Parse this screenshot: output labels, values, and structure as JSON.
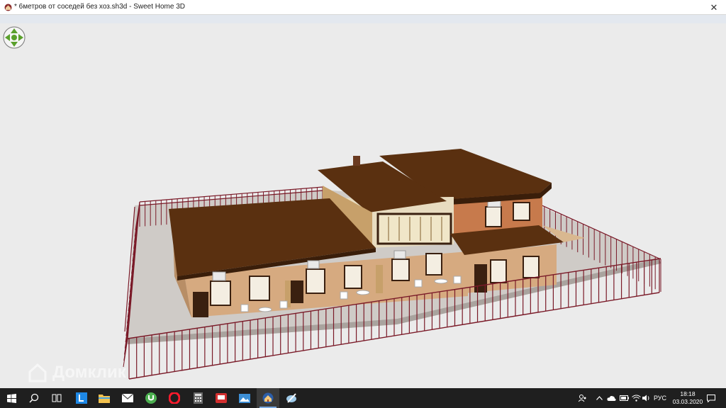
{
  "window": {
    "title": "* 6метров от соседей без хоз.sh3d - Sweet Home 3D",
    "close_glyph": "✕"
  },
  "viewport": {
    "navigation_icon": "navigation-arrows-icon",
    "watermark": "Домклик"
  },
  "taskbar": {
    "apps": [
      {
        "name": "start-icon"
      },
      {
        "name": "search-icon"
      },
      {
        "name": "task-view-icon"
      },
      {
        "name": "l-app-icon"
      },
      {
        "name": "file-explorer-icon"
      },
      {
        "name": "mail-icon"
      },
      {
        "name": "utorrent-icon"
      },
      {
        "name": "opera-icon"
      },
      {
        "name": "calculator-icon"
      },
      {
        "name": "presentation-app-icon"
      },
      {
        "name": "image-viewer-icon"
      },
      {
        "name": "sweet-home-3d-icon"
      },
      {
        "name": "drawing-app-icon"
      }
    ],
    "tray": {
      "language": "РУС",
      "time": "18:18",
      "date": "03.03.2020"
    }
  },
  "colors": {
    "background": "#ebebeb",
    "roof": "#5a3010",
    "wall": "#d6aa80",
    "fence": "#7a1a28",
    "taskbar": "#1f1f1f"
  }
}
